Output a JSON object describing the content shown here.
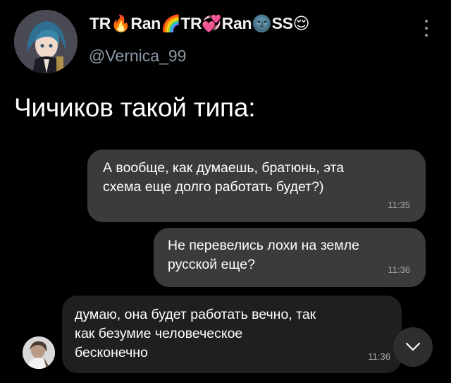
{
  "header": {
    "display_name": "TR🔥Ran🌈TR💞Ran🌚SS😌",
    "handle": "@Vernica_99",
    "more_icon": "more-vertical-icon"
  },
  "tweet": {
    "text": "Чичиков такой типа:"
  },
  "chat": {
    "messages": [
      {
        "direction": "outgoing",
        "lines": [
          "А вообще, как думаешь, братюнь, эта",
          "схема еще долго работать будет?)"
        ],
        "time": "11:35"
      },
      {
        "direction": "outgoing",
        "lines": [
          "Не перевелись лохи на земле",
          "русской еще?"
        ],
        "time": "11:36"
      },
      {
        "direction": "incoming",
        "lines": [
          "думаю, она будет работать вечно, так",
          "как безумие человеческое",
          "бесконечно"
        ],
        "time": "11:36"
      }
    ],
    "scroll_down_icon": "chevron-down-icon"
  },
  "colors": {
    "background": "#000000",
    "handle": "#8b98a5",
    "outgoing_bubble": "#3b3b3b",
    "incoming_bubble": "#1f1f1f",
    "timestamp": "#a8a8a8"
  }
}
